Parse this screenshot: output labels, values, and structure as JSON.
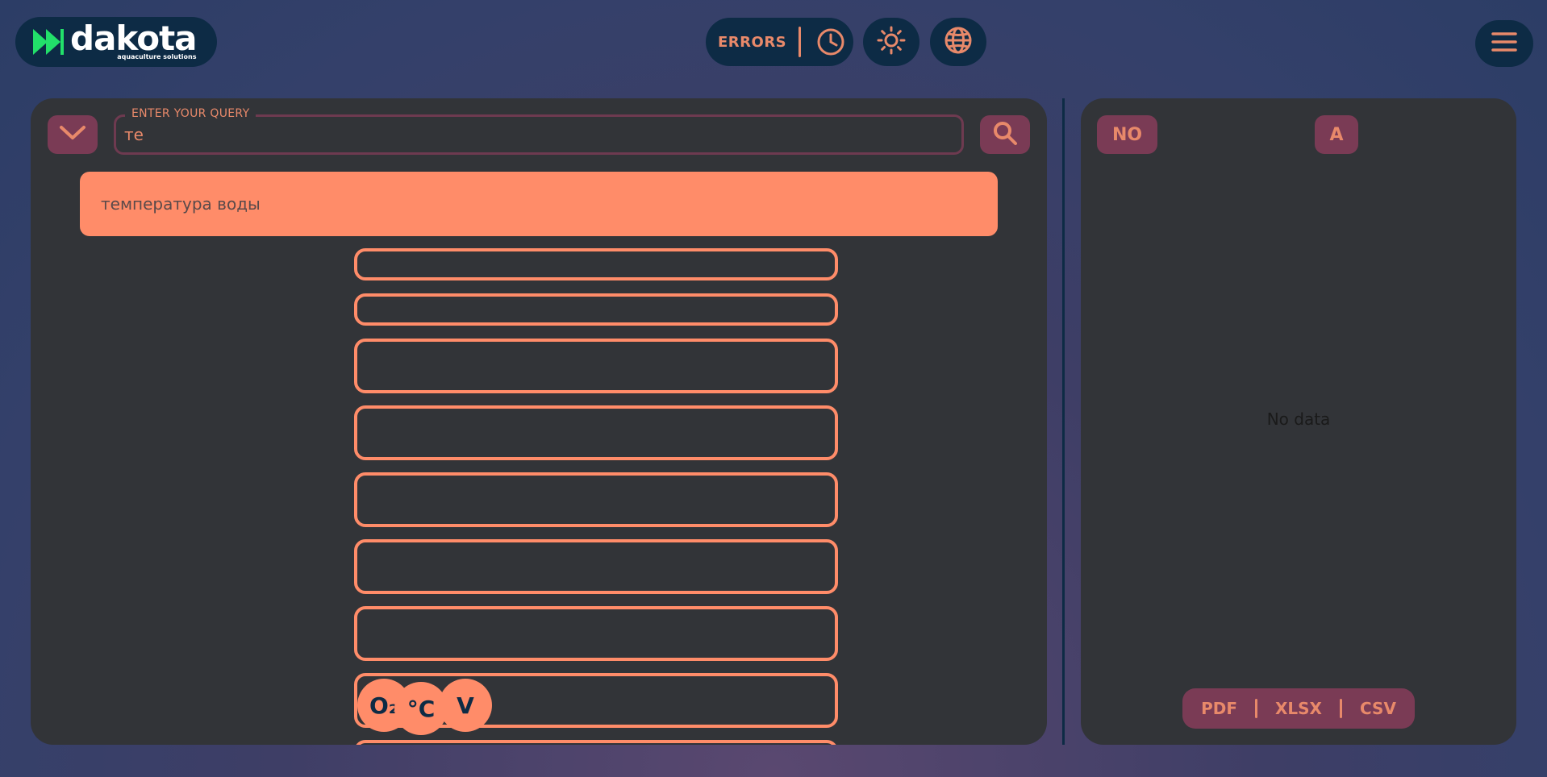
{
  "header": {
    "logo_brand": "dakota",
    "logo_tagline": "aquaculture solutions",
    "errors_label": "ERRORS",
    "icons": [
      "clock-icon",
      "sun-icon",
      "globe-icon",
      "menu-icon"
    ]
  },
  "query": {
    "legend": "ENTER YOUR QUERY",
    "value": "те",
    "suggestion": "температура воды"
  },
  "sensors": {
    "oxygen": "O₂",
    "temperature": "°C",
    "voltage": "V"
  },
  "right_panel": {
    "btn_no": "NO",
    "btn_a": "A",
    "no_data": "No data",
    "export": {
      "pdf": "PDF",
      "xlsx": "XLSX",
      "csv": "CSV"
    }
  },
  "colors": {
    "accent": "#ff8c69",
    "navy": "#0d2b45",
    "panel": "#323438",
    "button": "#7a3b55"
  }
}
